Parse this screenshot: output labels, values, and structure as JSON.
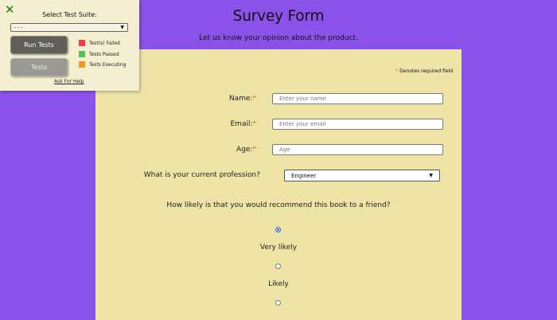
{
  "header": {
    "title": "Survey Form",
    "subtitle": "Let us know your opinion about the product."
  },
  "form": {
    "required_note_star": "*",
    "required_note": "Denotes required field",
    "name": {
      "label": "Name:",
      "star": "*",
      "placeholder": "Enter your name"
    },
    "email": {
      "label": "Email:",
      "star": "*",
      "placeholder": "Enter your email"
    },
    "age": {
      "label": "Age:",
      "star": "*",
      "placeholder": "Age"
    },
    "profession": {
      "label": "What is your current profession?",
      "selected": "Engineer"
    },
    "recommend": {
      "question": "How likely is that you would recommend this book to a friend?",
      "options": [
        {
          "label": "Very likely",
          "checked": true
        },
        {
          "label": "Likely",
          "checked": false
        },
        {
          "label": "",
          "checked": false
        }
      ]
    }
  },
  "test_suite": {
    "close_glyph": "✕",
    "title": "Select Test Suite:",
    "selected": "- - -",
    "run_button": "Run Tests",
    "tests_button": "Tests",
    "legend": [
      {
        "label": "Test(s) Failed",
        "color": "#e8453c"
      },
      {
        "label": "Tests Passed",
        "color": "#4fc35a"
      },
      {
        "label": "Tests Executing",
        "color": "#f59a1b"
      }
    ],
    "help_link": "Ask For Help"
  },
  "colors": {
    "background": "#8a52e8",
    "form_panel": "#eee4a6",
    "accent_radio": "#2a62d6"
  }
}
